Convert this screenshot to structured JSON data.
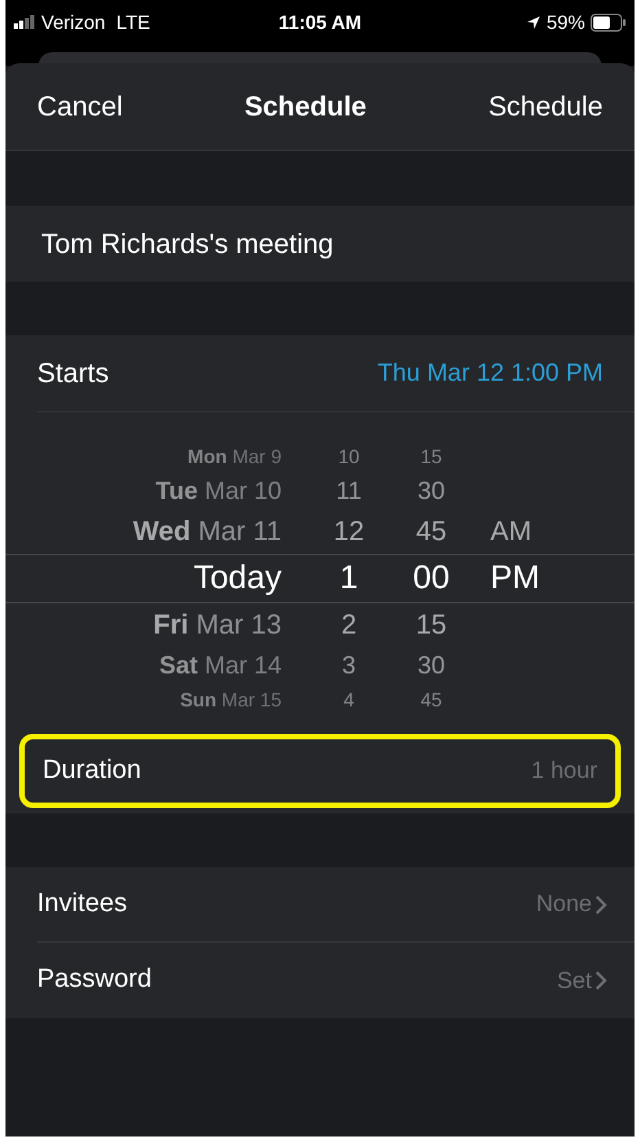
{
  "status_bar": {
    "carrier": "Verizon",
    "network": "LTE",
    "time": "11:05 AM",
    "battery": "59%"
  },
  "nav": {
    "cancel": "Cancel",
    "title": "Schedule",
    "action": "Schedule"
  },
  "meeting_name": "Tom Richards's meeting",
  "starts": {
    "label": "Starts",
    "value": "Thu Mar 12 1:00 PM"
  },
  "picker_rows": [
    {
      "weekday": "Mon",
      "date": "Mar 9",
      "hour": "10",
      "minute": "15",
      "selected": false
    },
    {
      "weekday": "Tue",
      "date": "Mar 10",
      "hour": "11",
      "minute": "30",
      "selected": false
    },
    {
      "weekday": "Wed",
      "date": "Mar 11",
      "hour": "12",
      "minute": "45",
      "period": "AM",
      "selected": false
    },
    {
      "weekday": "Today",
      "hour": "1",
      "minute": "00",
      "period": "PM",
      "selected": true
    },
    {
      "weekday": "Fri",
      "date": "Mar 13",
      "hour": "2",
      "minute": "15",
      "selected": false
    },
    {
      "weekday": "Sat",
      "date": "Mar 14",
      "hour": "3",
      "minute": "30",
      "selected": false
    },
    {
      "weekday": "Sun",
      "date": "Mar 15",
      "hour": "4",
      "minute": "45",
      "selected": false
    }
  ],
  "duration": {
    "label": "Duration",
    "value": "1 hour",
    "highlighted": true
  },
  "options": [
    {
      "label": "Invitees",
      "value": "None"
    },
    {
      "label": "Password",
      "value": "Set"
    }
  ]
}
